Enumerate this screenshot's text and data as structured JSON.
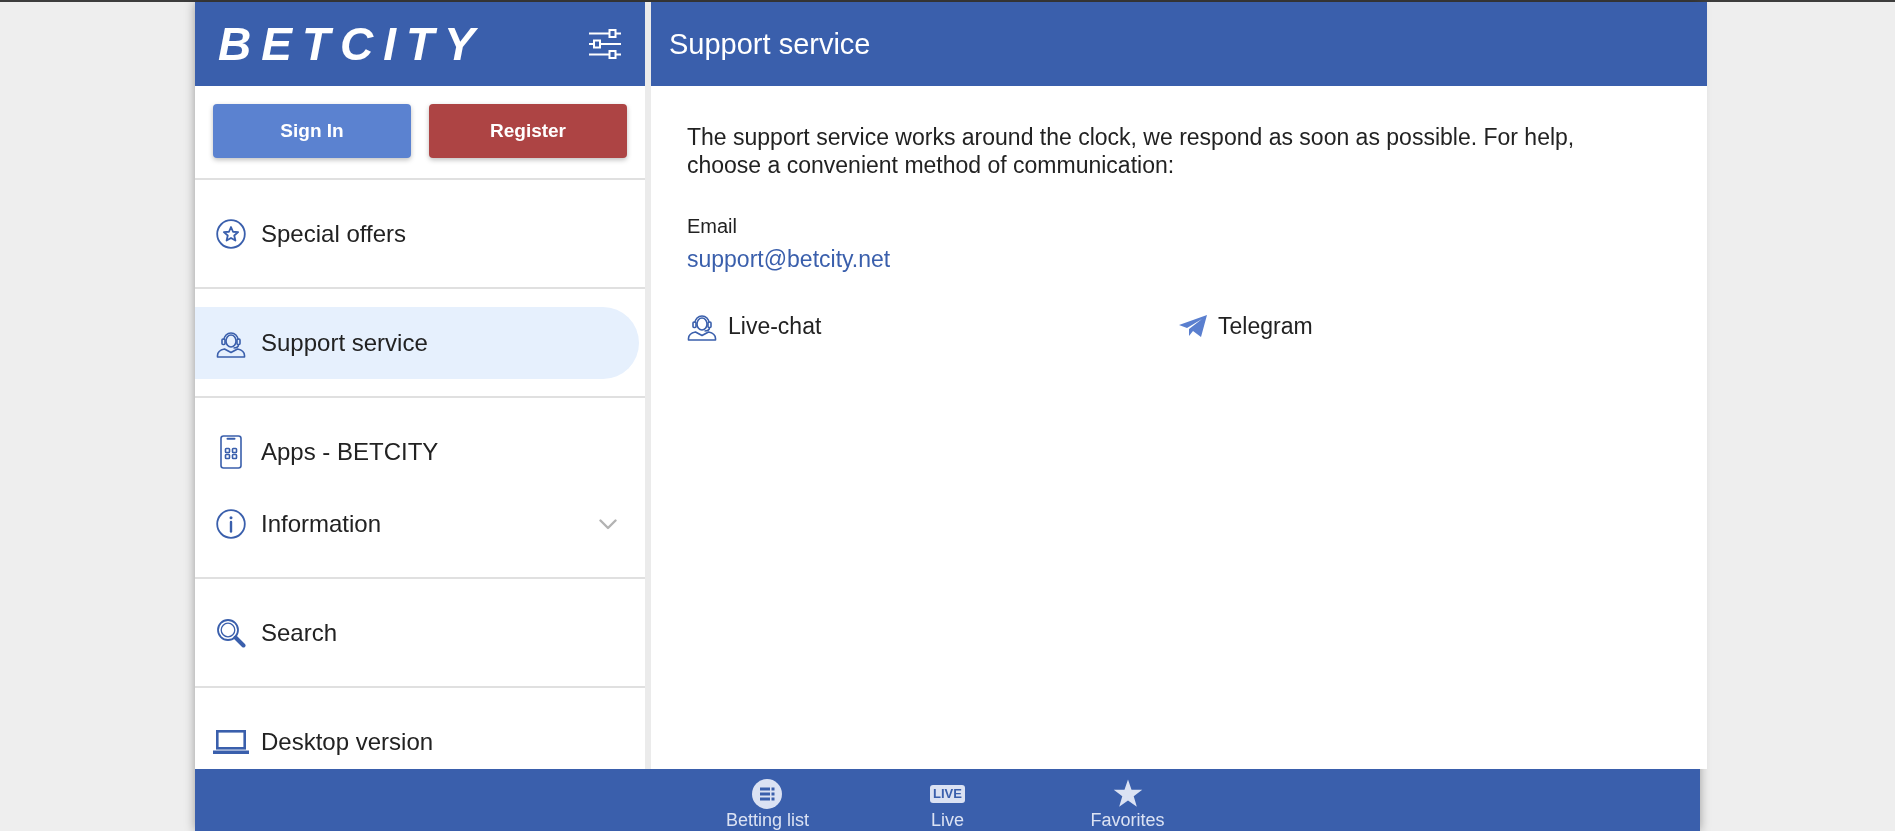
{
  "header": {
    "logo": "BETCITY"
  },
  "auth": {
    "buttons": [
      {
        "kind": "signin",
        "label": "Sign In"
      },
      {
        "kind": "register",
        "label": "Register"
      }
    ]
  },
  "sidebar": {
    "sections": [
      {
        "items": [
          {
            "kind": "link",
            "label": "Special offers",
            "selected": false
          }
        ]
      },
      {
        "items": [
          {
            "kind": "link",
            "label": "Support service",
            "selected": true
          }
        ]
      },
      {
        "items": [
          {
            "kind": "link",
            "label": "Apps - BETCITY",
            "selected": false
          },
          {
            "kind": "menu",
            "label": "Information",
            "selected": false,
            "expanded": false
          }
        ]
      },
      {
        "items": [
          {
            "kind": "link",
            "label": "Search",
            "selected": false
          }
        ]
      },
      {
        "items": [
          {
            "kind": "link",
            "label": "Desktop version",
            "selected": false
          }
        ]
      }
    ]
  },
  "page": {
    "title": "Support service",
    "intro": "The support service works around the clock, we respond as soon as possible. For help, choose a convenient method of communication:",
    "email_label": "Email",
    "email": "support@betcity.net",
    "contacts": [
      {
        "label": "Live-chat"
      },
      {
        "label": "Telegram"
      }
    ]
  },
  "bottom_nav": {
    "items": [
      {
        "label": "Betting list"
      },
      {
        "label": "Live",
        "badge": "LIVE"
      },
      {
        "label": "Favorites"
      }
    ]
  }
}
